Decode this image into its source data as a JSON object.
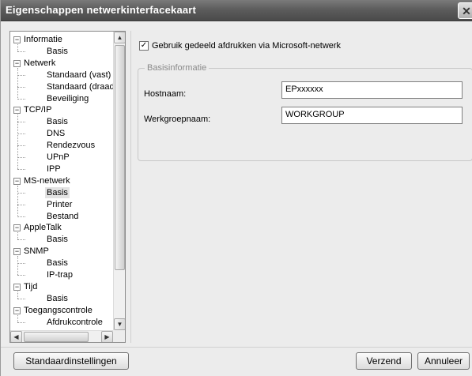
{
  "window": {
    "title": "Eigenschappen netwerkinterfacekaart",
    "close_glyph": "✕"
  },
  "tree": {
    "items": [
      {
        "label": "Informatie",
        "level": 0,
        "expander": "−"
      },
      {
        "label": "Basis",
        "level": 1
      },
      {
        "label": "Netwerk",
        "level": 0,
        "expander": "−"
      },
      {
        "label": "Standaard (vast)",
        "level": 1
      },
      {
        "label": "Standaard (draadl",
        "level": 1
      },
      {
        "label": "Beveiliging",
        "level": 1
      },
      {
        "label": "TCP/IP",
        "level": 0,
        "expander": "−"
      },
      {
        "label": "Basis",
        "level": 1
      },
      {
        "label": "DNS",
        "level": 1
      },
      {
        "label": "Rendezvous",
        "level": 1
      },
      {
        "label": "UPnP",
        "level": 1
      },
      {
        "label": "IPP",
        "level": 1
      },
      {
        "label": "MS-netwerk",
        "level": 0,
        "expander": "−"
      },
      {
        "label": "Basis",
        "level": 1,
        "selected": true
      },
      {
        "label": "Printer",
        "level": 1
      },
      {
        "label": "Bestand",
        "level": 1
      },
      {
        "label": "AppleTalk",
        "level": 0,
        "expander": "−"
      },
      {
        "label": "Basis",
        "level": 1
      },
      {
        "label": "SNMP",
        "level": 0,
        "expander": "−"
      },
      {
        "label": "Basis",
        "level": 1
      },
      {
        "label": "IP-trap",
        "level": 1
      },
      {
        "label": "Tijd",
        "level": 0,
        "expander": "−"
      },
      {
        "label": "Basis",
        "level": 1
      },
      {
        "label": "Toegangscontrole",
        "level": 0,
        "expander": "−"
      },
      {
        "label": "Afdrukcontrole",
        "level": 1
      }
    ],
    "scroll_up": "▲",
    "scroll_down": "▼",
    "scroll_left": "◀",
    "scroll_right": "▶"
  },
  "content": {
    "share_checkbox": {
      "label": "Gebruik gedeeld afdrukken via Microsoft-netwerk",
      "checked": true,
      "mark": "✓"
    },
    "group_title": "Basisinformatie",
    "hostname_label": "Hostnaam:",
    "hostname_value": "EPxxxxxx",
    "workgroup_label": "Werkgroepnaam:",
    "workgroup_value": "WORKGROUP"
  },
  "buttons": {
    "defaults": "Standaardinstellingen",
    "send": "Verzend",
    "cancel": "Annuleer"
  }
}
